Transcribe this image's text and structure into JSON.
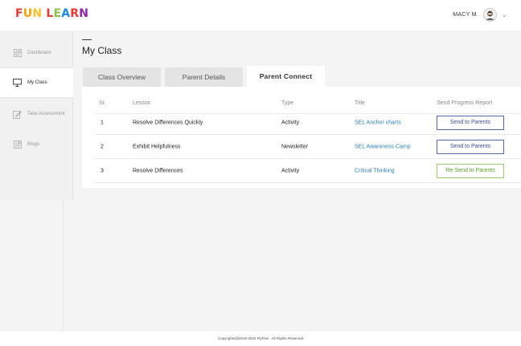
{
  "app": {
    "logo_letters": [
      {
        "ch": "F",
        "color": "#e53935"
      },
      {
        "ch": "U",
        "color": "#f4a000"
      },
      {
        "ch": "N",
        "color": "#fbc02d"
      },
      {
        "ch": " ",
        "color": "#ffffff"
      },
      {
        "ch": "L",
        "color": "#e53935"
      },
      {
        "ch": "E",
        "color": "#8bc34a"
      },
      {
        "ch": "A",
        "color": "#1e88e5"
      },
      {
        "ch": "R",
        "color": "#e53935"
      },
      {
        "ch": "N",
        "color": "#8e24aa"
      }
    ]
  },
  "user": {
    "name": "MACY M.",
    "avatar_icon": "user-avatar-icon",
    "menu_icon": "chevron-down-icon"
  },
  "sidebar": {
    "items": [
      {
        "label": "Dashboard",
        "icon": "dashboard-icon",
        "active": false
      },
      {
        "label": "My Class",
        "icon": "monitor-icon",
        "active": true
      },
      {
        "label": "Take Assessment",
        "icon": "edit-icon",
        "active": false
      },
      {
        "label": "Blogs",
        "icon": "blog-icon",
        "active": false
      }
    ]
  },
  "page": {
    "title": "My Class"
  },
  "tabs": [
    {
      "label": "Class Overview",
      "active": false
    },
    {
      "label": "Parent Details",
      "active": false
    },
    {
      "label": "Parent Connect",
      "active": true
    }
  ],
  "table": {
    "headers": [
      "Sr.",
      "Lesson",
      "Type",
      "Title",
      "Send Progress Report"
    ],
    "rows": [
      {
        "sr": "1",
        "lesson": "Resolve Differences Quickly",
        "type": "Activity",
        "title": "SEL Anchor charts",
        "action": "Send to Parents",
        "action_kind": "send"
      },
      {
        "sr": "2",
        "lesson": "Exhibit Helpfulness",
        "type": "Newsletter",
        "title": "SEL Awareness Camp",
        "action": "Send to Parents",
        "action_kind": "send"
      },
      {
        "sr": "3",
        "lesson": "Resolve Differences",
        "type": "Activity",
        "title": "Critical Thinking",
        "action": "Re-Send to Parents",
        "action_kind": "resend"
      }
    ]
  },
  "footer": {
    "text": "Copyrights@2019-2020 FlyFive . All Rights Reserved"
  },
  "colors": {
    "send": "#3b4a9b",
    "resend": "#5aa02c",
    "link": "#2e7fb8"
  }
}
